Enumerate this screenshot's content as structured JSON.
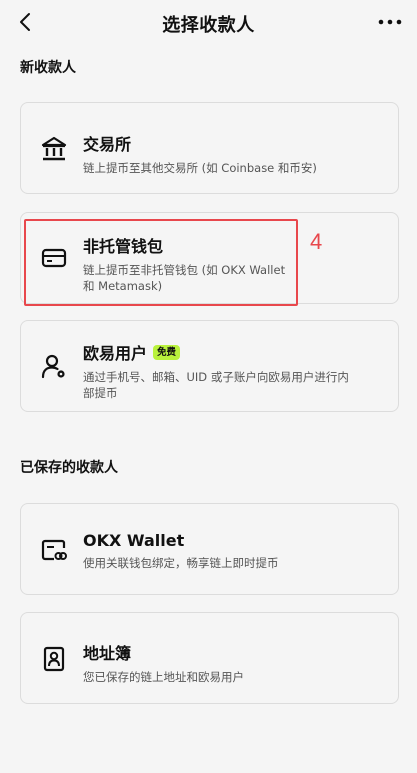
{
  "header": {
    "title": "选择收款人",
    "back_icon": "chevron-left-icon",
    "more_icon": "more-horizontal-icon"
  },
  "sections": {
    "new": "新收款人",
    "saved": "已保存的收款人"
  },
  "new_payees": [
    {
      "id": "exchange",
      "icon": "bank-icon",
      "title": "交易所",
      "desc": "链上提币至其他交易所 (如 Coinbase 和币安)"
    },
    {
      "id": "noncustodial",
      "icon": "card-icon",
      "title": "非托管钱包",
      "desc_line1": "链上提币至非托管钱包 (如 OKX Wallet",
      "desc_line2": "和 Metamask)"
    },
    {
      "id": "okx-user",
      "icon": "user-icon",
      "title": "欧易用户",
      "badge": "免费",
      "desc_line1": "通过手机号、邮箱、UID 或子账户向欧易用户进行内",
      "desc_line2": "部提币"
    }
  ],
  "saved_payees": [
    {
      "id": "okx-wallet",
      "icon": "wallet-link-icon",
      "title": "OKX Wallet",
      "desc": "使用关联钱包绑定，畅享链上即时提币"
    },
    {
      "id": "address-book",
      "icon": "address-book-icon",
      "title": "地址簿",
      "desc": "您已保存的链上地址和欧易用户"
    }
  ],
  "annotation": {
    "number": "4",
    "color": "#e8474c"
  },
  "colors": {
    "badge": "#b9f23c",
    "background": "#f5f5f5",
    "border": "#dcdcdc"
  }
}
